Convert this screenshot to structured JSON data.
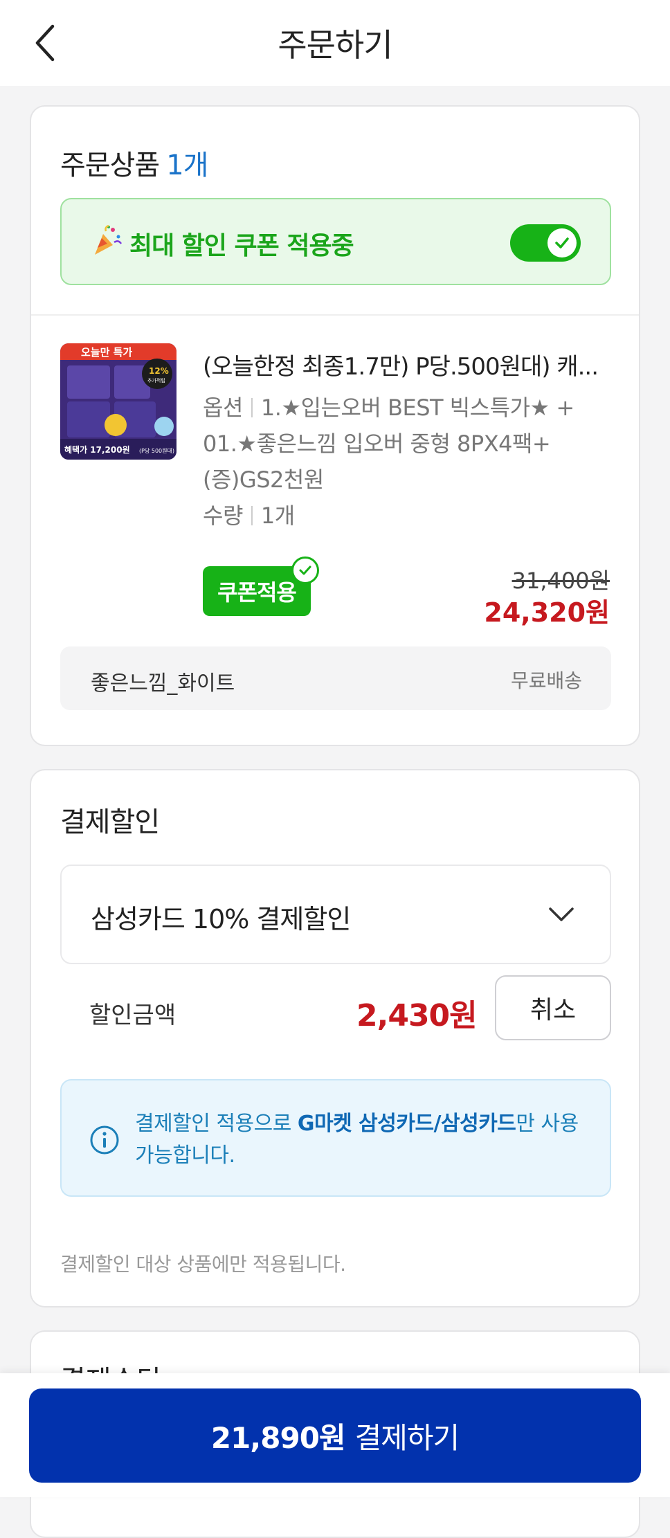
{
  "header": {
    "title": "주문하기",
    "back_icon": "chevron-left-icon"
  },
  "order_items": {
    "title": "주문상품",
    "count": "1개",
    "coupon_banner": {
      "emoji": "party-popper-icon",
      "text": "최대 할인 쿠폰 적용중",
      "toggle_on": true
    },
    "product": {
      "name": "(오늘한정 최종1.7만) P당.500원대) 캐...",
      "option_label": "옵션",
      "option_line1": "1.★입는오버 BEST 빅스특가★ +",
      "option_line2": "01.★좋은느낌 입오버 중형 8PX4팩+",
      "option_line3": "(증)GS2천원",
      "qty_label": "수량",
      "qty_value": "1개",
      "coupon_button": "쿠폰적용",
      "original_price": "31,400원",
      "sale_price": "24,320원",
      "thumbnail": {
        "top_banner": "오늘만 특가",
        "badge_pct": "12%",
        "badge_sub": "추가적립",
        "price_text": "혜택가 17,200원",
        "price_sub": "(P당 500원대)"
      }
    },
    "seller": {
      "name": "좋은느낌_화이트",
      "shipping": "무료배송"
    }
  },
  "payment_discount": {
    "title": "결제할인",
    "selected_option": "삼성카드 10% 결제할인",
    "discount_label": "할인금액",
    "discount_amount": "2,430원",
    "cancel_button": "취소",
    "info_prefix": "결제할인 적용으로 ",
    "info_bold": "G마켓 삼성카드/삼성카드",
    "info_suffix": "만 사용 가능합니다.",
    "note": "결제할인 대상 상품에만 적용됩니다."
  },
  "payment_method": {
    "title": "결제수단"
  },
  "bottom": {
    "amount": "21,890원",
    "label": "결제하기"
  },
  "colors": {
    "accent_green": "#17b217",
    "price_red": "#c6191f",
    "primary_blue": "#0232ad",
    "info_blue": "#1b7fb8"
  }
}
